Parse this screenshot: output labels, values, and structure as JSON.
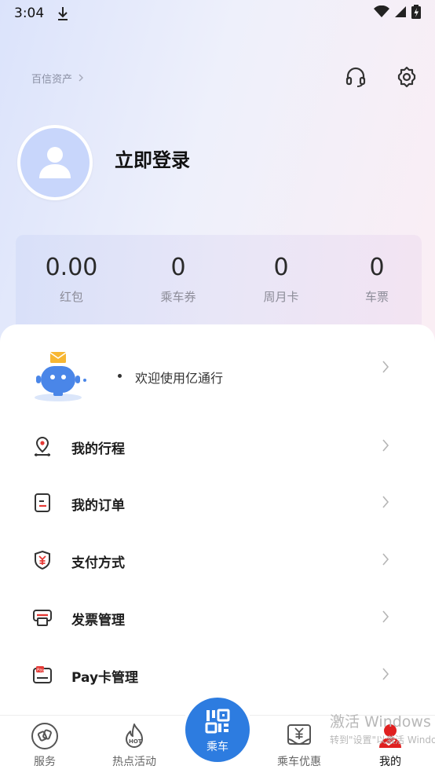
{
  "status_bar": {
    "time": "3:04"
  },
  "header": {
    "brand_link": "百信资产",
    "login_text": "立即登录"
  },
  "wallet": [
    {
      "value": "0.00",
      "label": "红包"
    },
    {
      "value": "0",
      "label": "乘车券"
    },
    {
      "value": "0",
      "label": "周月卡"
    },
    {
      "value": "0",
      "label": "车票"
    }
  ],
  "notice": {
    "text": "欢迎使用亿通行"
  },
  "menu": [
    {
      "label": "我的行程",
      "icon": "location-pin-icon"
    },
    {
      "label": "我的订单",
      "icon": "order-document-icon"
    },
    {
      "label": "支付方式",
      "icon": "yuan-shield-icon"
    },
    {
      "label": "发票管理",
      "icon": "printer-icon"
    },
    {
      "label": "Pay卡管理",
      "icon": "pay-card-icon"
    }
  ],
  "tabs": [
    {
      "label": "服务",
      "icon": "service-icon"
    },
    {
      "label": "热点活动",
      "icon": "hot-flame-icon"
    },
    {
      "label": "乘车",
      "icon": "qr-code-icon"
    },
    {
      "label": "乘车优惠",
      "icon": "discount-ticket-icon"
    },
    {
      "label": "我的",
      "icon": "profile-icon"
    }
  ],
  "watermark": {
    "line1": "激活 Windows",
    "line2": "转到\"设置\"以激活 Windows。"
  },
  "colors": {
    "accent_blue": "#2d7ce0",
    "active_red": "#e02020",
    "icon_red": "#e53935"
  }
}
